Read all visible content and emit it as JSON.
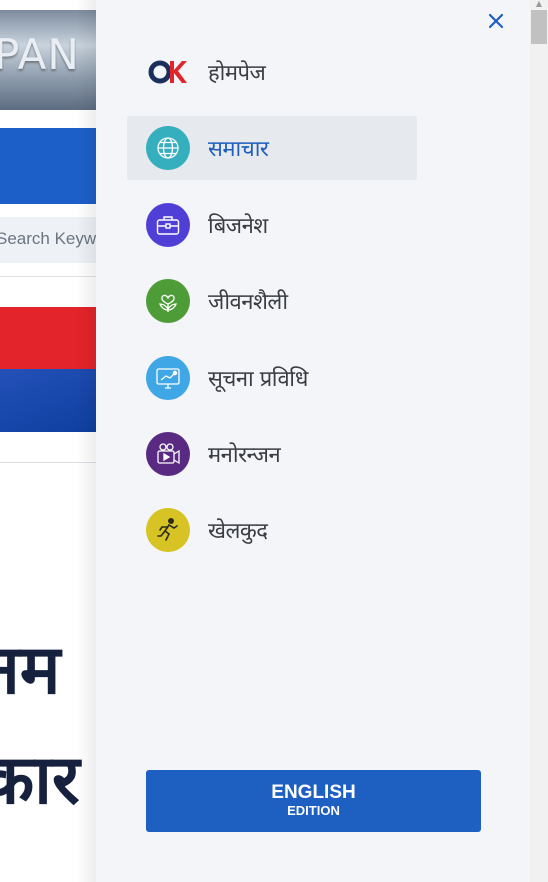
{
  "background": {
    "banner_text": "PAN",
    "search_placeholder": "Search Keyw",
    "headline_line1": "नम",
    "headline_line2": "कार"
  },
  "drawer": {
    "close_symbol": "✕",
    "menu_items": [
      {
        "label": "होमपेज",
        "icon": "brand-logo-icon",
        "color": "#d32f2f"
      },
      {
        "label": "समाचार",
        "icon": "globe-icon",
        "color": "#35aebd",
        "active": true
      },
      {
        "label": "बिजनेश",
        "icon": "briefcase-icon",
        "color": "#4f3fd6"
      },
      {
        "label": "जीवनशैली",
        "icon": "heart-plant-icon",
        "color": "#4e9c38"
      },
      {
        "label": "सूचना प्रविधि",
        "icon": "monitor-chart-icon",
        "color": "#3fa7e6"
      },
      {
        "label": "मनोरन्जन",
        "icon": "video-camera-icon",
        "color": "#5a2a82"
      },
      {
        "label": "खेलकुद",
        "icon": "runner-icon",
        "color": "#d7c323"
      }
    ],
    "edition_button": {
      "main": "ENGLISH",
      "sub": "EDITION"
    }
  },
  "colors": {
    "accent": "#1e5fc2",
    "active_bg": "#e6e9ed",
    "drawer_bg": "#f3f5f8"
  }
}
